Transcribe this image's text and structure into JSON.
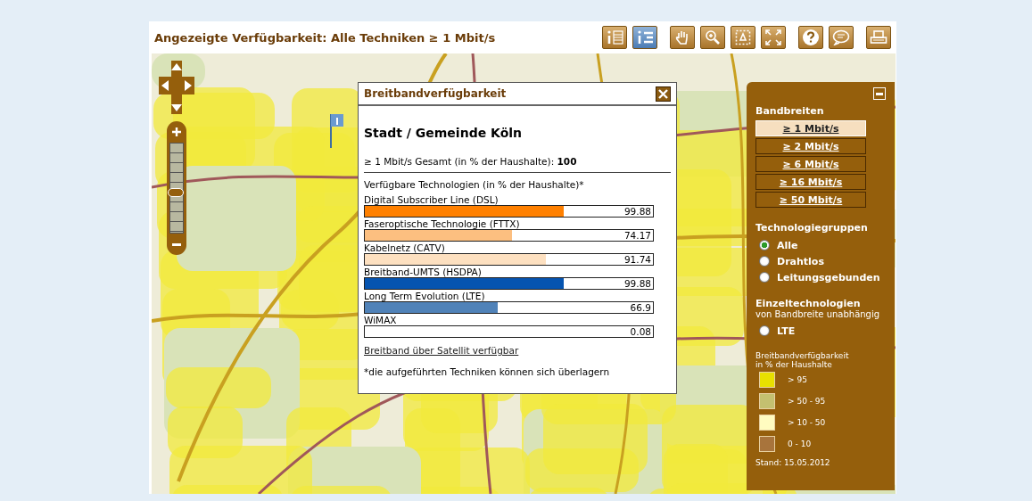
{
  "header": {
    "title": "Angezeigte Verfügbarkeit: Alle Techniken ≥ 1 Mbit/s"
  },
  "zoom": {
    "level": 0.45
  },
  "toolbar": [
    {
      "kind": "info-table",
      "selected": false
    },
    {
      "kind": "info-list",
      "selected": true
    },
    {
      "kind": "hand",
      "selected": false
    },
    {
      "kind": "zoom",
      "selected": false
    },
    {
      "kind": "area",
      "selected": false
    },
    {
      "kind": "fullscreen",
      "selected": false
    },
    {
      "kind": "help",
      "selected": false
    },
    {
      "kind": "comment",
      "selected": false
    },
    {
      "kind": "print",
      "selected": false
    }
  ],
  "popup": {
    "title": "Breitbandverfügbarkeit",
    "heading": "Stadt / Gemeinde Köln",
    "total_label": "≥ 1 Mbit/s Gesamt (in % der Haushalte):",
    "total_value": "100",
    "section": "Verfügbare Technologien (in % der Haushalte)*",
    "bars": [
      {
        "label": "Digital Subscriber Line (DSL)",
        "value": "99.88",
        "level": 0.69,
        "color": "#ff8000"
      },
      {
        "label": "Faseroptische Technologie (FTTX)",
        "value": "74.17",
        "level": 0.51,
        "color": "#fcbf80"
      },
      {
        "label": "Kabelnetz (CATV)",
        "value": "91.74",
        "level": 0.63,
        "color": "#fde0c0"
      },
      {
        "label": "Breitband-UMTS (HSDPA)",
        "value": "99.88",
        "level": 0.69,
        "color": "#0654b0"
      },
      {
        "label": "Long Term Evolution (LTE)",
        "value": "66.9",
        "level": 0.46,
        "color": "#5082b8"
      },
      {
        "label": "WiMAX",
        "value": "0.08"
      }
    ],
    "link": "Breitband über Satellit verfügbar",
    "footnote": "*die aufgeführten Techniken können sich überlagern"
  },
  "legend": {
    "bandwidth_title": "Bandbreiten",
    "bandwidths": [
      {
        "label": "≥ 1 Mbit/s",
        "selected": true
      },
      {
        "label": "≥ 2 Mbit/s",
        "selected": false
      },
      {
        "label": "≥ 6 Mbit/s",
        "selected": false
      },
      {
        "label": "≥ 16 Mbit/s",
        "selected": false
      },
      {
        "label": "≥ 50 Mbit/s",
        "selected": false
      }
    ],
    "groups_title": "Technologiegruppen",
    "groups": [
      {
        "label": "Alle",
        "selected": true
      },
      {
        "label": "Drahtlos",
        "selected": false
      },
      {
        "label": "Leitungsgebunden",
        "selected": false
      }
    ],
    "single_title": "Einzeltechnologien",
    "single_subtitle": "von Bandbreite unabhängig",
    "single": [
      {
        "label": "LTE",
        "selected": false
      }
    ],
    "scale_title": "Breitbandverfügbarkeit",
    "scale_subtitle": "in % der Haushalte",
    "scale": [
      {
        "label": "> 95",
        "color": "#e8e000"
      },
      {
        "label": "> 50 - 95",
        "color": "#c4c070"
      },
      {
        "label": "> 10 - 50",
        "color": "#fffcc0"
      },
      {
        "label": "0 - 10",
        "color": "#a8743c"
      }
    ],
    "date": "Stand: 15.05.2012"
  }
}
